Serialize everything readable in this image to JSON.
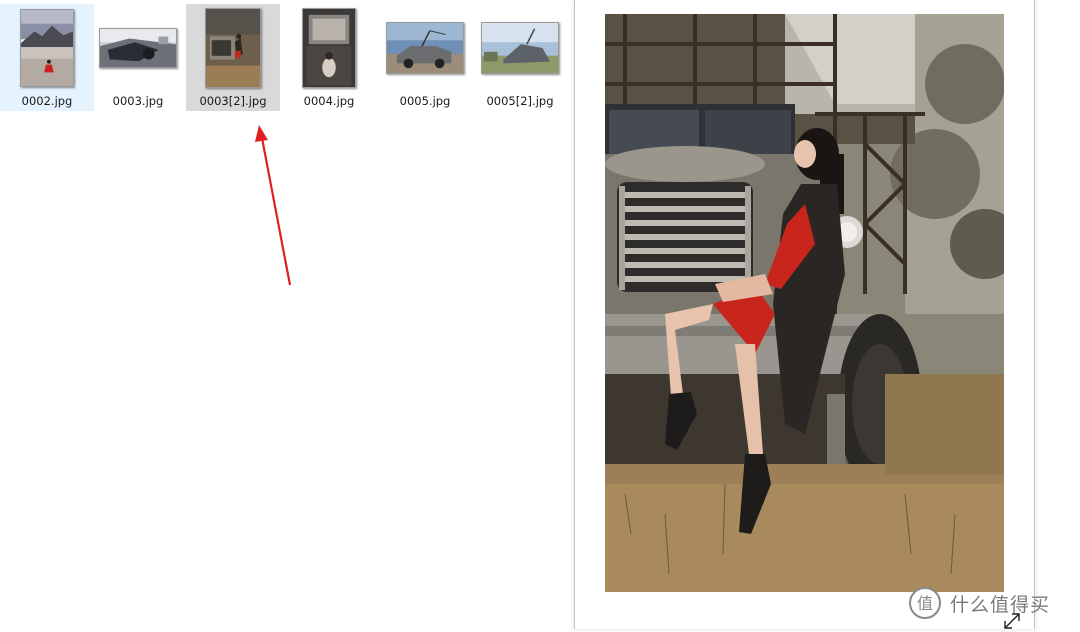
{
  "files": [
    {
      "name": "0002.jpg",
      "state": "hover"
    },
    {
      "name": "0003.jpg",
      "state": "normal"
    },
    {
      "name": "0003[2].jpg",
      "state": "selected"
    },
    {
      "name": "0004.jpg",
      "state": "normal"
    },
    {
      "name": "0005.jpg",
      "state": "normal"
    },
    {
      "name": "0005[2].jpg",
      "state": "normal"
    }
  ],
  "colors": {
    "hover_bg": "#e5f3ff",
    "selected_bg": "#d9d9d9",
    "annotation_arrow": "#e02020"
  },
  "preview": {
    "icons": [
      "resize-icon"
    ]
  },
  "watermark": {
    "text": "什么值得买",
    "logo_glyph": "值"
  }
}
